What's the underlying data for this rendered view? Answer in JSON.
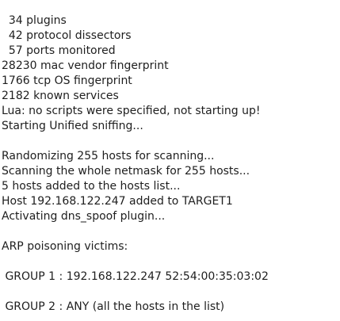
{
  "terminal": {
    "lines": [
      "  34 plugins",
      "  42 protocol dissectors",
      "  57 ports monitored",
      "28230 mac vendor fingerprint",
      "1766 tcp OS fingerprint",
      "2182 known services",
      "Lua: no scripts were specified, not starting up!",
      "Starting Unified sniffing...",
      "",
      "Randomizing 255 hosts for scanning...",
      "Scanning the whole netmask for 255 hosts...",
      "5 hosts added to the hosts list...",
      "Host 192.168.122.247 added to TARGET1",
      "Activating dns_spoof plugin...",
      "",
      "ARP poisoning victims:",
      "",
      " GROUP 1 : 192.168.122.247 52:54:00:35:03:02",
      "",
      " GROUP 2 : ANY (all the hosts in the list)"
    ]
  }
}
